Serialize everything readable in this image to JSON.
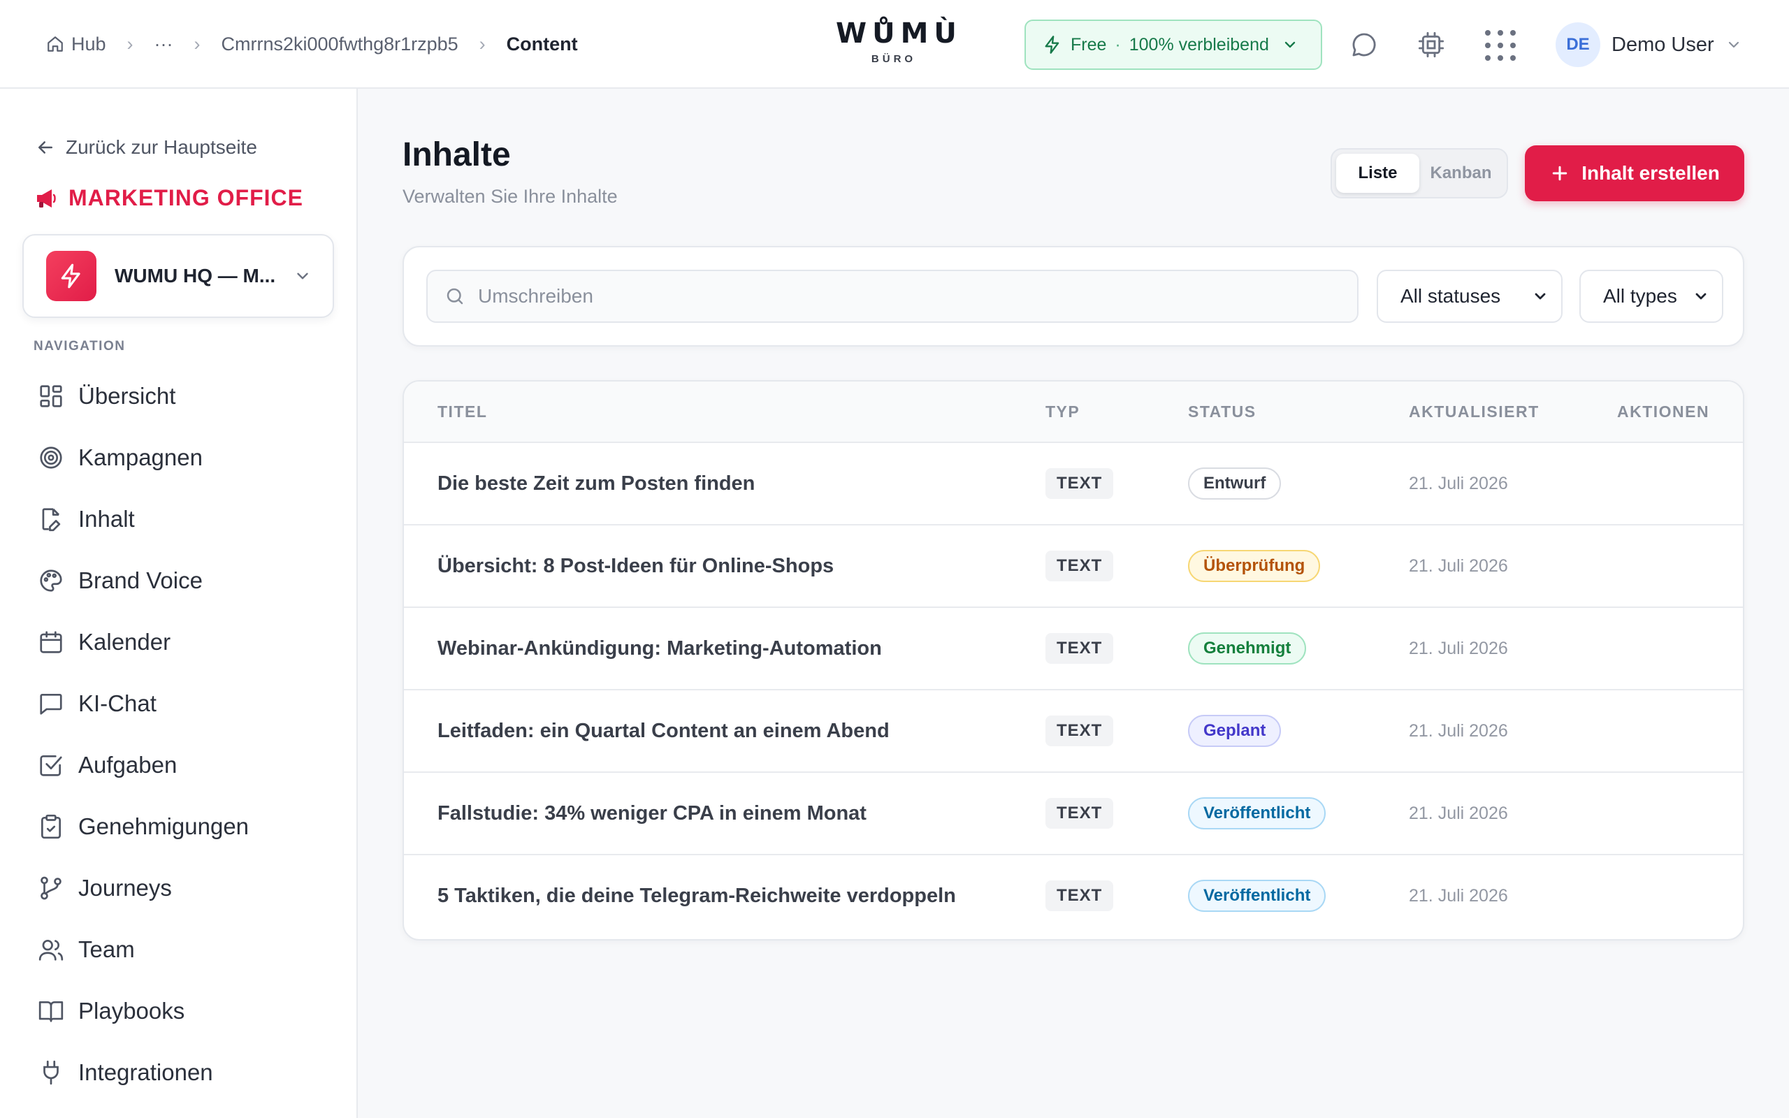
{
  "breadcrumb": {
    "hub": "Hub",
    "ellipsis": "···",
    "project": "Cmrrns2ki000fwthg8r1rzpb5",
    "current": "Content"
  },
  "logo": {
    "main": "WŮMÙ",
    "sub": "BÜRO"
  },
  "plan": {
    "name": "Free",
    "separator": "·",
    "remaining": "100% verbleibend"
  },
  "user": {
    "initials": "DE",
    "name": "Demo User"
  },
  "sidebar": {
    "back": "Zurück zur Hauptseite",
    "office": "MARKETING OFFICE",
    "workspace": "WUMU HQ — M...",
    "nav_label": "NAVIGATION",
    "items": [
      {
        "label": "Übersicht",
        "icon": "grid-icon"
      },
      {
        "label": "Kampagnen",
        "icon": "target-icon"
      },
      {
        "label": "Inhalt",
        "icon": "file-edit-icon"
      },
      {
        "label": "Brand Voice",
        "icon": "palette-icon"
      },
      {
        "label": "Kalender",
        "icon": "calendar-icon"
      },
      {
        "label": "KI-Chat",
        "icon": "chat-icon"
      },
      {
        "label": "Aufgaben",
        "icon": "check-square-icon"
      },
      {
        "label": "Genehmigungen",
        "icon": "clipboard-check-icon"
      },
      {
        "label": "Journeys",
        "icon": "git-branch-icon"
      },
      {
        "label": "Team",
        "icon": "users-icon"
      },
      {
        "label": "Playbooks",
        "icon": "book-icon"
      },
      {
        "label": "Integrationen",
        "icon": "plug-icon"
      }
    ]
  },
  "main": {
    "title": "Inhalte",
    "subtitle": "Verwalten Sie Ihre Inhalte",
    "view_toggle": {
      "list": "Liste",
      "kanban": "Kanban",
      "active": "list"
    },
    "create_button": "Inhalt erstellen"
  },
  "filters": {
    "search_placeholder": "Umschreiben",
    "status": "All statuses",
    "type": "All types"
  },
  "table": {
    "columns": [
      "TITEL",
      "TYP",
      "STATUS",
      "AKTUALISIERT",
      "AKTIONEN"
    ],
    "rows": [
      {
        "title": "Die beste Zeit zum Posten finden",
        "type": "TEXT",
        "status": "Entwurf",
        "status_kind": "draft",
        "updated": "21. Juli 2026"
      },
      {
        "title": "Übersicht: 8 Post-Ideen für Online-Shops",
        "type": "TEXT",
        "status": "Überprüfung",
        "status_kind": "review",
        "updated": "21. Juli 2026"
      },
      {
        "title": "Webinar-Ankündigung: Marketing-Automation",
        "type": "TEXT",
        "status": "Genehmigt",
        "status_kind": "approved",
        "updated": "21. Juli 2026"
      },
      {
        "title": "Leitfaden: ein Quartal Content an einem Abend",
        "type": "TEXT",
        "status": "Geplant",
        "status_kind": "planned",
        "updated": "21. Juli 2026"
      },
      {
        "title": "Fallstudie: 34% weniger CPA in einem Monat",
        "type": "TEXT",
        "status": "Veröffentlicht",
        "status_kind": "published",
        "updated": "21. Juli 2026"
      },
      {
        "title": "5 Taktiken, die deine Telegram-Reichweite verdoppeln",
        "type": "TEXT",
        "status": "Veröffentlicht",
        "status_kind": "published",
        "updated": "21. Juli 2026"
      }
    ]
  },
  "colors": {
    "accent": "#e11d48",
    "plan_green": "#177a4a"
  }
}
